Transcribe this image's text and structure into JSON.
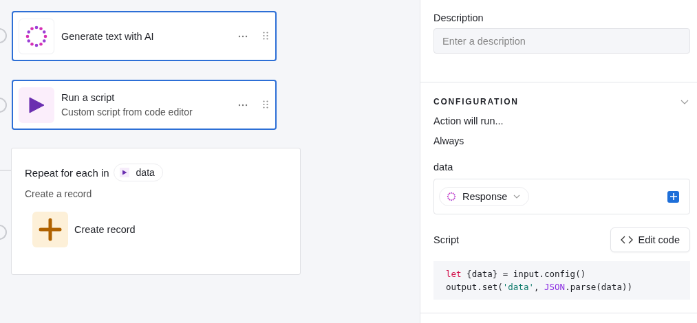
{
  "canvas": {
    "steps": [
      {
        "kind": "ai",
        "title": "Generate text with AI",
        "selected": true
      },
      {
        "kind": "script",
        "title": "Run a script",
        "subtitle": "Custom script from code editor",
        "selected": true
      }
    ],
    "repeat": {
      "title": "Repeat for each in",
      "token": "data",
      "subtitle": "Create a record",
      "action": {
        "kind": "create",
        "title": "Create record"
      }
    }
  },
  "panel": {
    "description": {
      "label": "Description",
      "placeholder": "Enter a description"
    },
    "configuration": {
      "heading": "CONFIGURATION",
      "expanded": true,
      "run_label": "Action will run...",
      "run_value": "Always",
      "data": {
        "label": "data",
        "token": "Response"
      },
      "script": {
        "label": "Script",
        "button": "Edit code",
        "code": [
          [
            {
              "kind": "keyword",
              "text": "let"
            },
            {
              "kind": "plain",
              "text": " {data} = input.config()"
            }
          ],
          [
            {
              "kind": "plain",
              "text": "output.set("
            },
            {
              "kind": "string",
              "text": "'data'"
            },
            {
              "kind": "plain",
              "text": ", "
            },
            {
              "kind": "builtin",
              "text": "JSON"
            },
            {
              "kind": "plain",
              "text": ".parse(data))"
            }
          ]
        ]
      }
    }
  }
}
